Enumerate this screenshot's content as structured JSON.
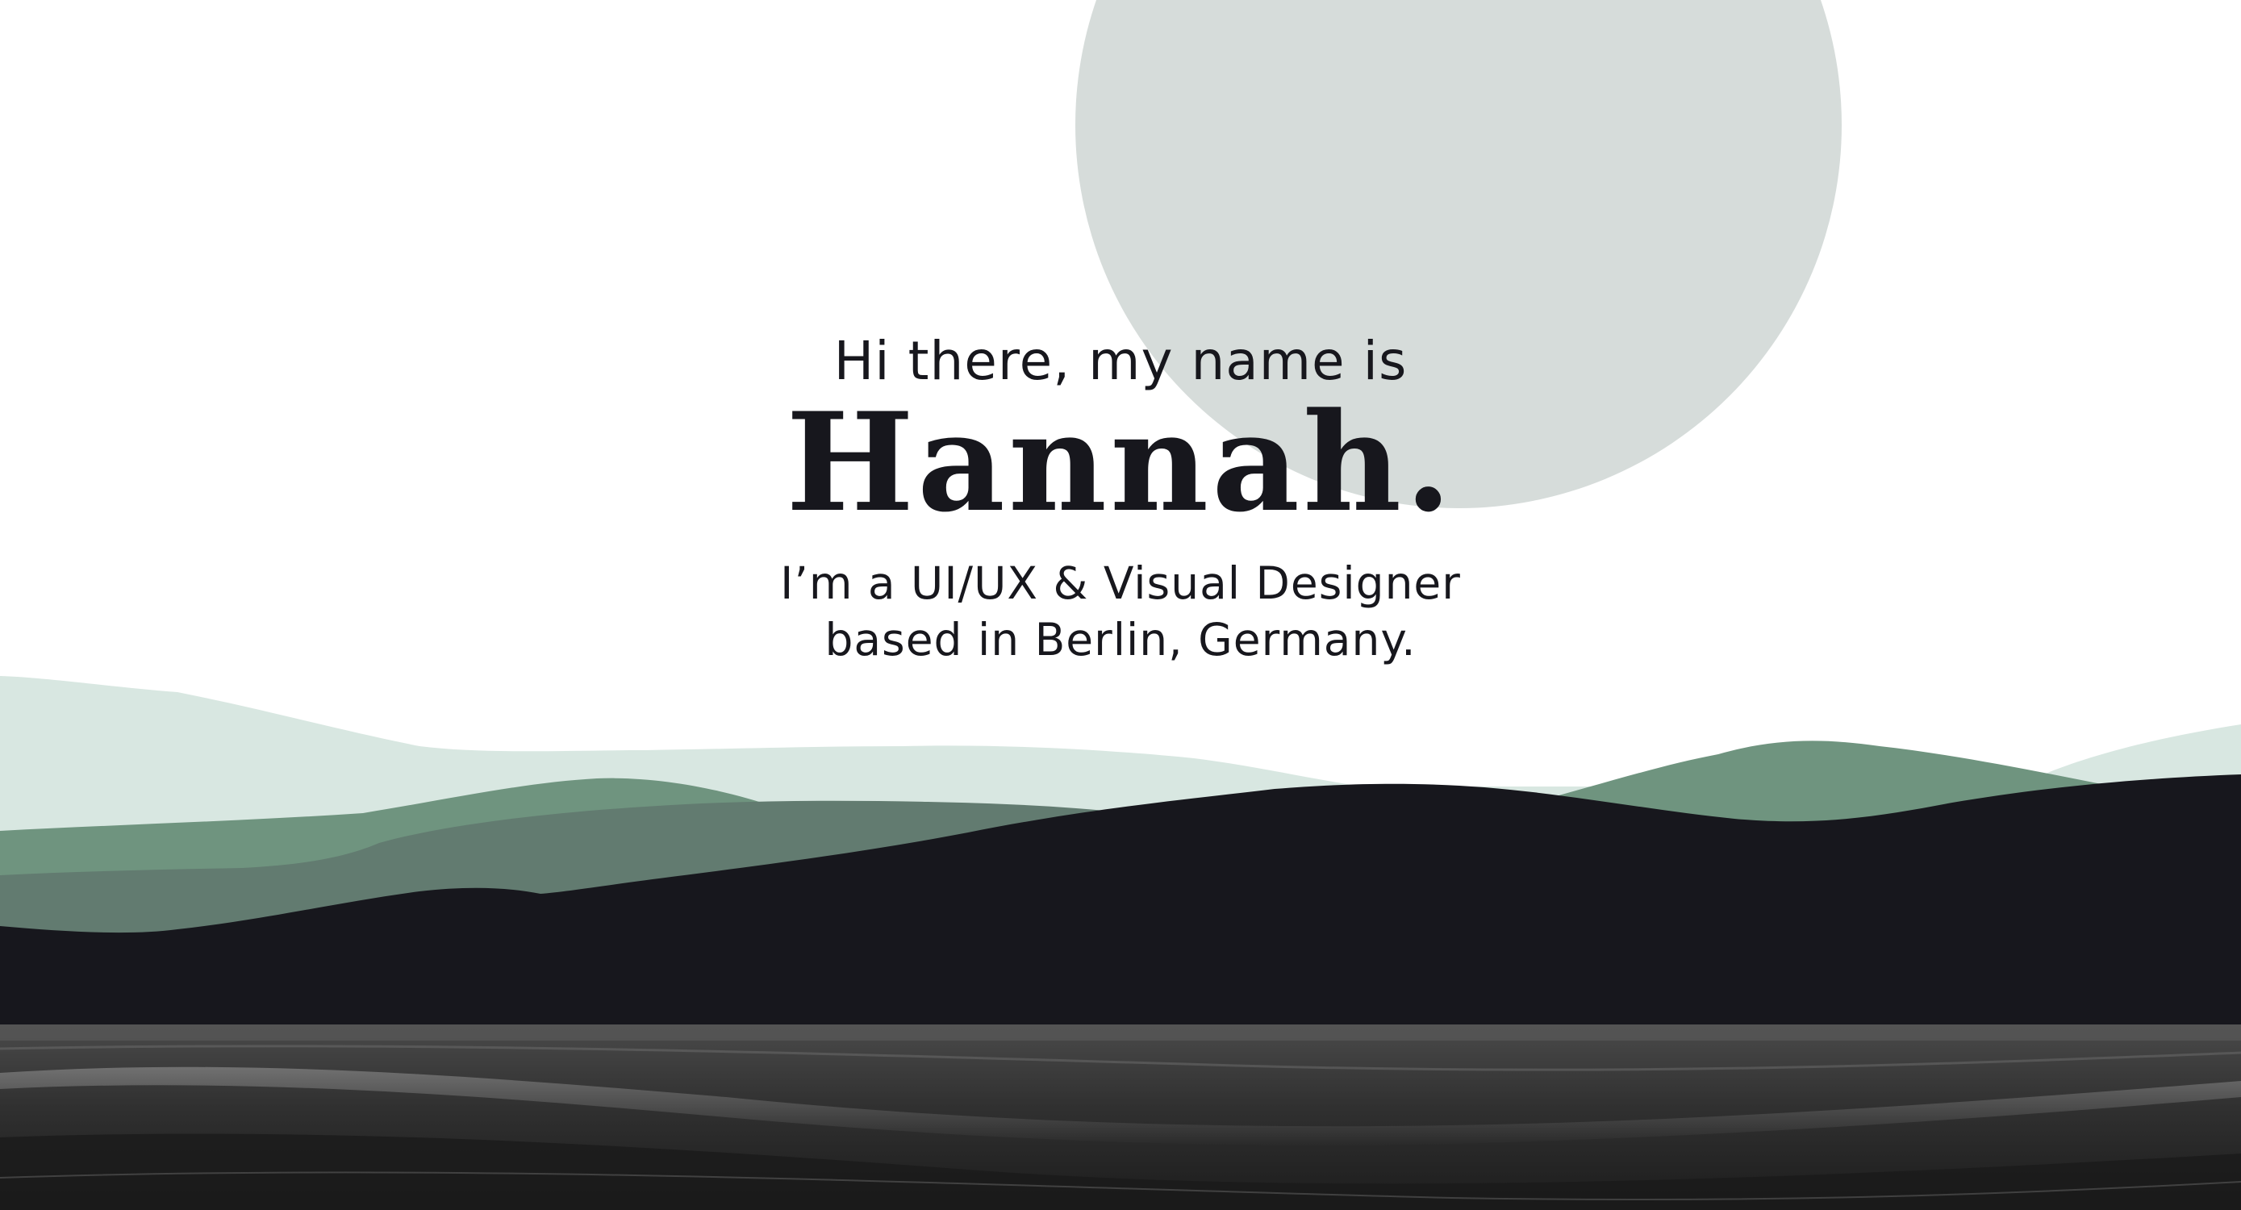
{
  "hero": {
    "greeting": "Hi there, my name is",
    "name": "Hannah.",
    "tagline_line1": "I’m a UI/UX & Visual Designer",
    "tagline_line2": "based in Berlin, Germany."
  },
  "colors": {
    "background": "#ffffff",
    "sun": "#d6dcda",
    "hill_far": "#d8e7e1",
    "hill_mid": "#6f947f",
    "hill_slate": "#627b70",
    "hill_dark": "#17171d",
    "sea": "#3f3f3f",
    "text": "#17171d"
  },
  "icons": {
    "sun": "sun-circle",
    "mountains": "mountain-layers",
    "sea": "ocean-waves"
  }
}
